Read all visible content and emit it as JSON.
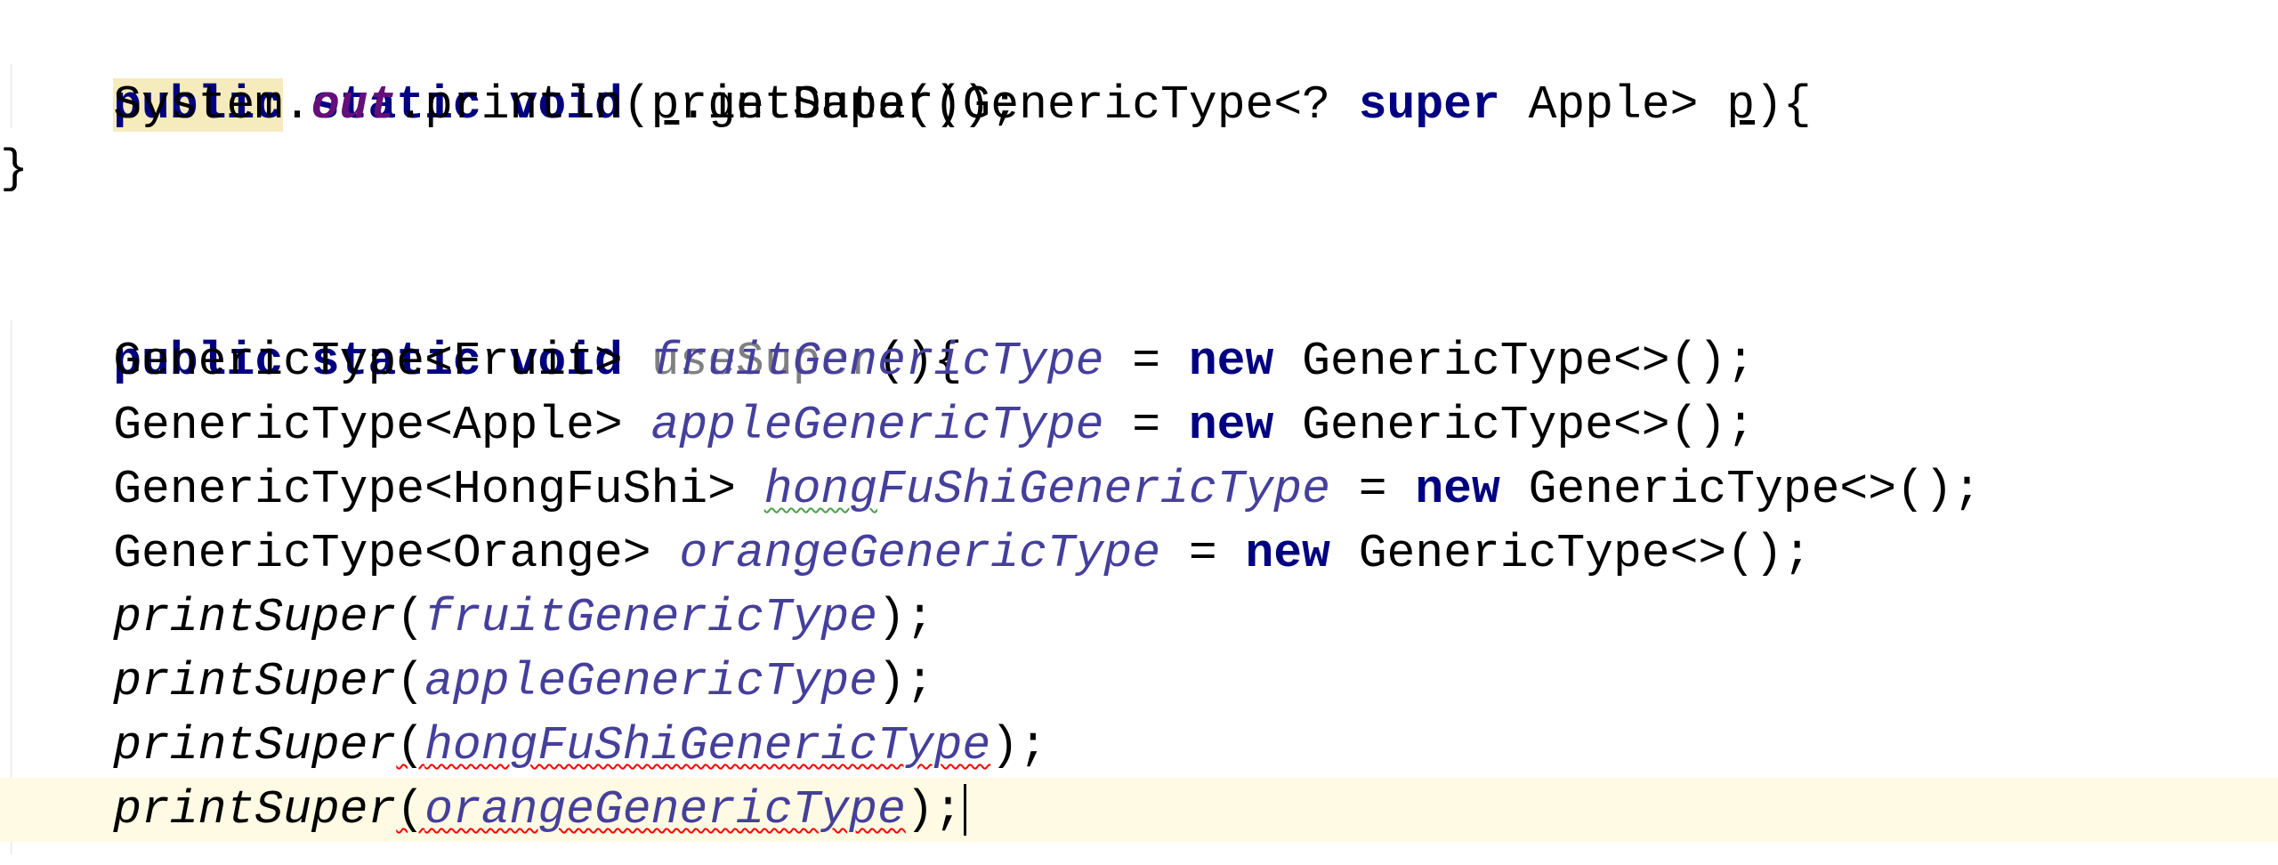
{
  "editor": {
    "lines": [
      {
        "tokens": {
          "kw1": "public",
          "kw2": "static",
          "kw3": "void",
          "name": "printSuper",
          "open": "(",
          "type": "GenericType<?",
          "kw4": "super",
          "bound": "Apple>",
          "param": "p",
          "close": "){"
        }
      },
      {
        "tokens": {
          "sys": "System.",
          "out": "out",
          "println": ".println(",
          "p": "p",
          "rest": ".getData());"
        }
      },
      {
        "tokens": {
          "brace": "}"
        }
      },
      {
        "tokens": {}
      },
      {
        "tokens": {
          "kw1": "public",
          "kw2": "static",
          "kw3": "void",
          "name": "useSuper",
          "close": "(){"
        }
      },
      {
        "tokens": {
          "type": "GenericType<Fruit>",
          "var": "fruitGenericType",
          "eq": "=",
          "new": "new",
          "ctor": "GenericType<>();"
        }
      },
      {
        "tokens": {
          "type": "GenericType<Apple>",
          "var": "appleGenericType",
          "eq": "=",
          "new": "new",
          "ctor": "GenericType<>();"
        }
      },
      {
        "tokens": {
          "type": "GenericType<HongFuShi>",
          "var_a": "hong",
          "var_b": "FuShi",
          "var_c": "GenericType",
          "eq": "=",
          "new": "new",
          "ctor": "GenericType<>();"
        }
      },
      {
        "tokens": {
          "type": "GenericType<Orange>",
          "var": "orangeGenericType",
          "eq": "=",
          "new": "new",
          "ctor": "GenericType<>();"
        }
      },
      {
        "tokens": {
          "call": "printSuper",
          "open": "(",
          "arg": "fruitGenericType",
          "close": ");"
        }
      },
      {
        "tokens": {
          "call": "printSuper",
          "open": "(",
          "arg": "appleGenericType",
          "close": ");"
        }
      },
      {
        "tokens": {
          "call": "printSuper",
          "open": "(",
          "arg": "hongFuShiGenericType",
          "close": ");"
        }
      },
      {
        "tokens": {
          "call": "printSuper",
          "open": "(",
          "arg": "orangeGenericType",
          "close": ");"
        }
      }
    ],
    "colors": {
      "keyword": "#000080",
      "static_field": "#660e7a",
      "local_var": "#453f9c",
      "unused": "#808080",
      "current_line": "#fffae3",
      "error_underline": "#ff0000",
      "typo_underline": "#4c9e4c"
    }
  }
}
